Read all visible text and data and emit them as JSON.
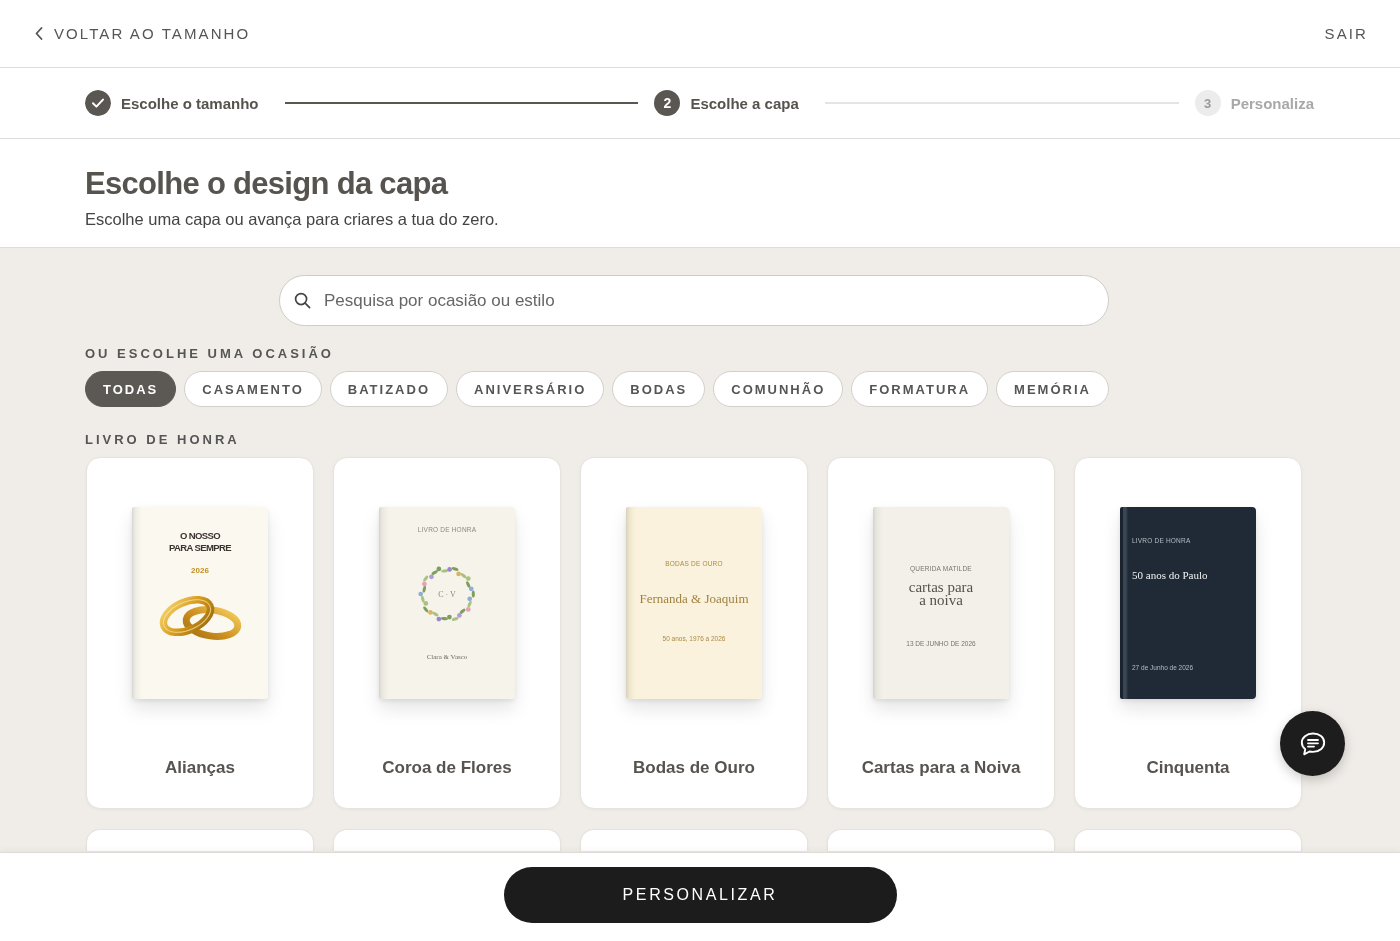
{
  "header": {
    "back_label": "VOLTAR AO TAMANHO",
    "exit_label": "SAIR"
  },
  "stepper": [
    {
      "label": "Escolhe o tamanho",
      "completed": true,
      "selected": false
    },
    {
      "number": "2",
      "label": "Escolhe a capa",
      "completed": false,
      "selected": true
    },
    {
      "number": "3",
      "label": "Personaliza",
      "completed": false,
      "selected": false
    }
  ],
  "intro": {
    "title": "Escolhe o design da capa",
    "subtitle": "Escolhe uma capa ou avança para criares a tua do zero."
  },
  "search": {
    "placeholder": "Pesquisa por ocasião ou estilo"
  },
  "occasions": {
    "heading": "OU ESCOLHE UMA OCASIÃO",
    "chips": [
      {
        "label": "TODAS",
        "selected": true
      },
      {
        "label": "CASAMENTO",
        "selected": false
      },
      {
        "label": "BATIZADO",
        "selected": false
      },
      {
        "label": "ANIVERSÁRIO",
        "selected": false
      },
      {
        "label": "BODAS",
        "selected": false
      },
      {
        "label": "COMUNHÃO",
        "selected": false
      },
      {
        "label": "FORMATURA",
        "selected": false
      },
      {
        "label": "MEMÓRIA",
        "selected": false
      }
    ]
  },
  "designs": {
    "heading": "LIVRO DE HONRA",
    "items": [
      {
        "name": "Alianças",
        "cover": {
          "kind": "rings",
          "title": "O NOSSO PARA SEMPRE",
          "subtitle": "2026"
        }
      },
      {
        "name": "Coroa de Flores",
        "cover": {
          "kind": "wreath",
          "kicker": "LIVRO DE HONRA",
          "title": "C · V",
          "subtitle": "Clara & Vasco"
        }
      },
      {
        "name": "Bodas de Ouro",
        "cover": {
          "kind": "gold",
          "kicker": "BODAS DE OURO",
          "title": "Fernanda & Joaquim",
          "subtitle": "50 anos, 1976 a 2026"
        }
      },
      {
        "name": "Cartas para a Noiva",
        "cover": {
          "kind": "letters",
          "kicker": "QUERIDA MATILDE",
          "title": "cartas para a noiva",
          "subtitle": "13 DE JUNHO DE 2026"
        }
      },
      {
        "name": "Cinquenta",
        "cover": {
          "kind": "dark",
          "kicker": "LIVRO DE HONRA",
          "title": "50 anos do Paulo",
          "subtitle": "27 de Junho de 2026"
        }
      }
    ]
  },
  "footer": {
    "button": "PERSONALIZAR"
  }
}
